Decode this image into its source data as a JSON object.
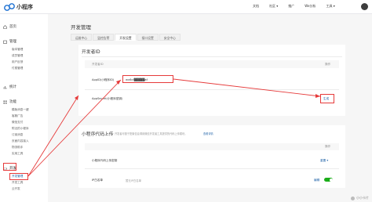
{
  "app": {
    "name": "小程序"
  },
  "topnav": [
    "文档",
    "社区 ▾",
    "推广",
    "We分析",
    "工具 ▾"
  ],
  "sidebar": {
    "groups": [
      {
        "label": "首页",
        "icon": "home-icon"
      },
      {
        "label": "管理",
        "icon": "folder-icon",
        "items": [
          "版本管理",
          "成员管理",
          "用户反馈",
          "付费管理"
        ]
      },
      {
        "label": "统计",
        "icon": "chart-icon"
      },
      {
        "label": "功能",
        "icon": "grid-icon",
        "items": [
          "模版消息一键",
          "客服广告",
          "微信支付",
          "附近的小程序",
          "订阅消息",
          "页面内容接入",
          "物流助手",
          "实用工具"
        ]
      },
      {
        "label": "开发",
        "icon": "code-icon",
        "items": [
          "开发管理",
          "开发工具",
          "云开发"
        ]
      }
    ]
  },
  "page": {
    "title": "开发管理",
    "tabs": [
      "运维中心",
      "监控告警",
      "开发设置",
      "接口设置",
      "安全中心"
    ],
    "active_tab": 2
  },
  "dev_id": {
    "heading": "开发者ID",
    "col_label": "开发者ID",
    "col_action": "操作",
    "rows": [
      {
        "label": "AppID(小程序ID)",
        "value": "wx6cf▓▓▓▓▓af",
        "action": ""
      },
      {
        "label": "AppSecret(小程序密钥)",
        "value": "",
        "action": "生成"
      }
    ]
  },
  "upload": {
    "heading": "小程序代码上传",
    "desc": "开发者可基于配置信息调用微信开发者工具提供的代码上传模块。",
    "desc_link": "查看详情",
    "col_action": "操作",
    "rows": [
      {
        "label": "小程序代码上传密钥",
        "value": "",
        "action": "重置 ▾"
      },
      {
        "label": "IP白名单",
        "value": "暂无IP白名单",
        "action": "编辑",
        "toggle": true
      }
    ]
  },
  "watermark": "小小卡片",
  "colors": {
    "accent": "#1aad19",
    "link": "#1d60a6",
    "highlight": "#e63a3a"
  }
}
